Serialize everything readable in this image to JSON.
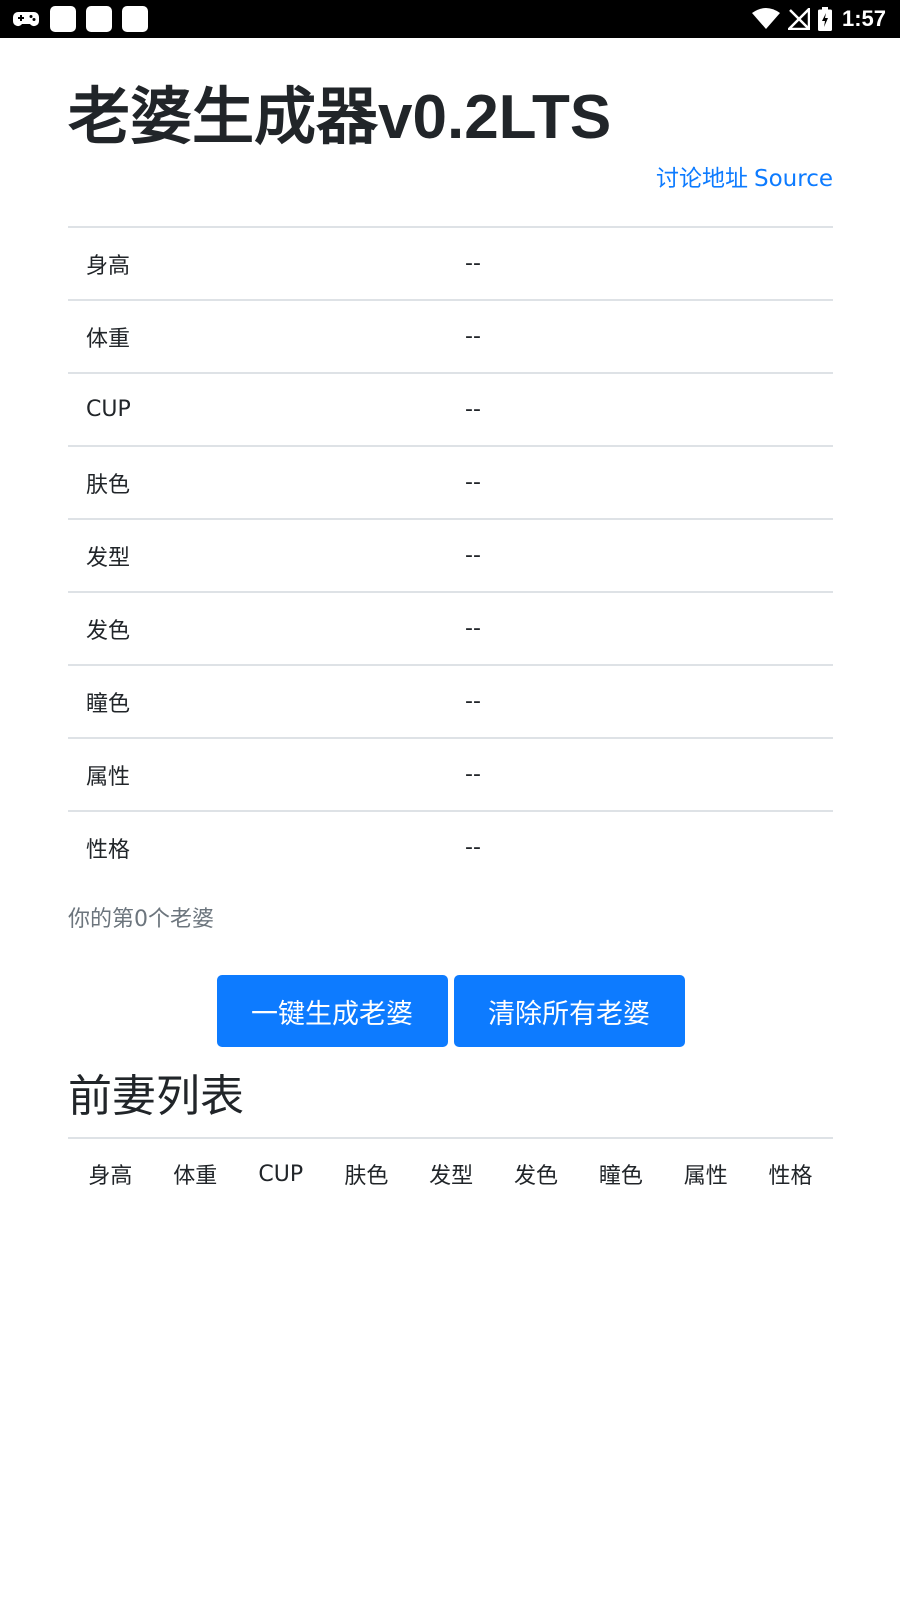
{
  "status_bar": {
    "time": "1:57",
    "icons": [
      "gamepad-icon",
      "app-icon",
      "app-icon",
      "app-icon",
      "wifi-icon",
      "no-signal-icon",
      "battery-icon"
    ]
  },
  "app": {
    "title": "老婆生成器v0.2LTS",
    "links": {
      "discussion": "讨论地址",
      "source": "Source"
    },
    "attributes": [
      {
        "label": "身高",
        "value": "--"
      },
      {
        "label": "体重",
        "value": "--"
      },
      {
        "label": "CUP",
        "value": "--"
      },
      {
        "label": "肤色",
        "value": "--"
      },
      {
        "label": "发型",
        "value": "--"
      },
      {
        "label": "发色",
        "value": "--"
      },
      {
        "label": "瞳色",
        "value": "--"
      },
      {
        "label": "属性",
        "value": "--"
      },
      {
        "label": "性格",
        "value": "--"
      }
    ],
    "counter_text": "你的第0个老婆",
    "buttons": {
      "generate": "一键生成老婆",
      "clear": "清除所有老婆"
    },
    "history": {
      "title": "前妻列表",
      "columns": [
        "身高",
        "体重",
        "CUP",
        "肤色",
        "发型",
        "发色",
        "瞳色",
        "属性",
        "性格"
      ]
    }
  },
  "colors": {
    "accent": "#0d7bff",
    "text": "#212529",
    "muted": "#6c757d",
    "divider": "#dee2e6"
  }
}
